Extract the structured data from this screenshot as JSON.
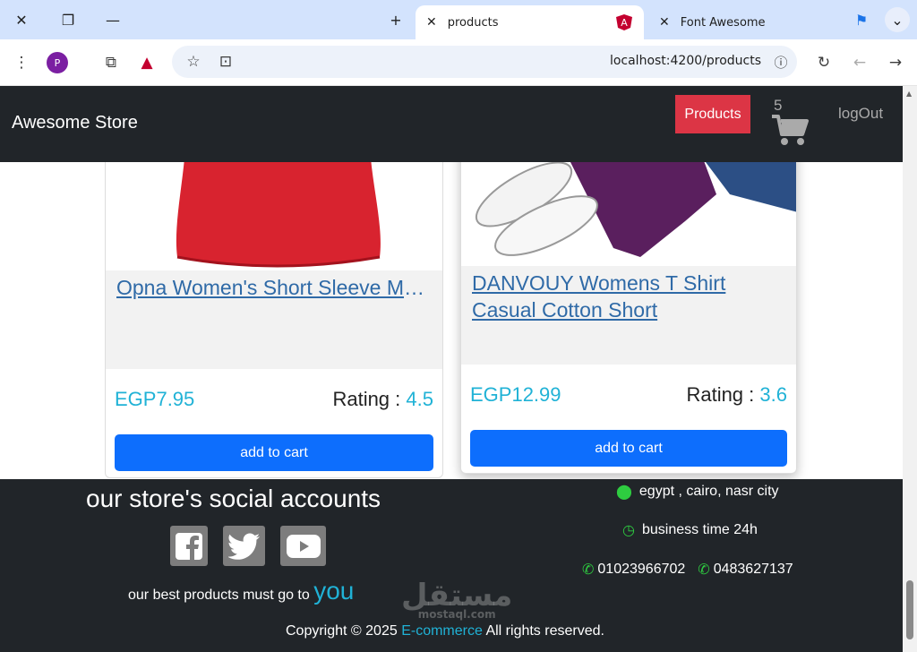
{
  "browser": {
    "tabs": [
      {
        "label": "products",
        "active": true
      },
      {
        "label": "Font Awesome",
        "active": false
      }
    ],
    "url": "localhost:4200/products"
  },
  "navbar": {
    "brand": "Awesome Store",
    "products_label": "Products",
    "cart_count": "5",
    "logout_label": "logOut"
  },
  "products": [
    {
      "title": "Opna Women's Short Sleeve Moisture",
      "price": "EGP7.95",
      "rating_label": "Rating :",
      "rating_value": "4.5",
      "button": "add to cart",
      "image_color": "#d8232f"
    },
    {
      "title": "DANVOUY Womens T Shirt Casual Cotton Short",
      "price": "EGP12.99",
      "rating_label": "Rating :",
      "rating_value": "3.6",
      "button": "add to cart",
      "image_color": "#5a1f5e"
    }
  ],
  "footer": {
    "heading": "our store's social accounts",
    "social_icons": [
      "facebook-icon",
      "twitter-icon",
      "youtube-icon"
    ],
    "tagline": "our best products must go to",
    "tagline_highlight": "you",
    "address": "egypt , cairo, nasr city",
    "hours": "business time 24h",
    "phone1": "01023966702",
    "phone2": "0483627137",
    "copyright_prefix": "Copyright © 2025",
    "copyright_brand": "E-commerce",
    "copyright_suffix": "All rights reserved."
  },
  "watermark": {
    "arabic": "مستقل",
    "latin": "mostaql.com"
  },
  "colors": {
    "accent": "#20b2d6",
    "danger": "#dc3545",
    "primary": "#0d6efd",
    "dark": "#212529"
  }
}
